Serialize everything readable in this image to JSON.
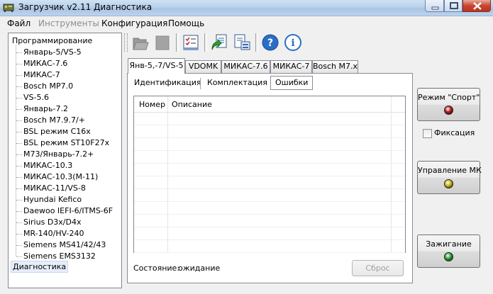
{
  "window": {
    "title": "Загрузчик v2.11 Диагностика"
  },
  "menu": [
    "Файл",
    "Инструменты",
    "Конфигурация",
    "Помощь"
  ],
  "menu_disabled": [
    "Инструменты"
  ],
  "tree": {
    "root": "Программирование",
    "children": [
      "Январь-5/VS-5",
      "МИКАС-7.6",
      "МИКАС-7",
      "Bosch MP7.0",
      "VS-5.6",
      "Январь-7.2",
      "Bosch M7.9.7/+",
      "BSL режим C16x",
      "BSL режим ST10F27x",
      "M73/Январь-7.2+",
      "МИКАС-10.3",
      "МИКАС-10.3(M-11)",
      "МИКАС-11/VS-8",
      "Hyundai Kefico",
      "Daewoo IEFI-6/ITMS-6F",
      "Sirius D3x/D4x",
      "MR-140/HV-240",
      "Siemens MS41/42/43",
      "Siemens EMS3132"
    ],
    "selected": "Диагностика"
  },
  "toolbar": {
    "icons": [
      "folder-icon",
      "stop-icon",
      "checklist-icon",
      "upload-icon",
      "download-icon",
      "help-icon",
      "info-icon"
    ]
  },
  "tabs": [
    "Янв-5,-7/VS-5",
    "VDOMK",
    "МИКАС-7.6",
    "МИКАС-7",
    "Bosch M7.x"
  ],
  "active_tab": "Янв-5,-7/VS-5",
  "subtabs": [
    "Идентификация",
    "Комплектация",
    "Ошибки"
  ],
  "active_subtab": "Ошибки",
  "grid": {
    "columns": [
      "Номер",
      "Описание"
    ],
    "rows": []
  },
  "status": {
    "label": "Состояние:",
    "value": "ожидание"
  },
  "reset_label": "Сброс",
  "controls": {
    "sport": {
      "label": "Режим \"Спорт\"",
      "lamp_color": "#b01818"
    },
    "fix": {
      "label": "Фиксация",
      "checked": false
    },
    "mk": {
      "label": "Управление МК",
      "lamp_color": "#c8b410"
    },
    "ignition": {
      "label": "Зажигание",
      "lamp_color": "#22a030"
    }
  },
  "colors": {
    "titlebar": "#b9d1ea",
    "panel": "#f0f0f0"
  }
}
